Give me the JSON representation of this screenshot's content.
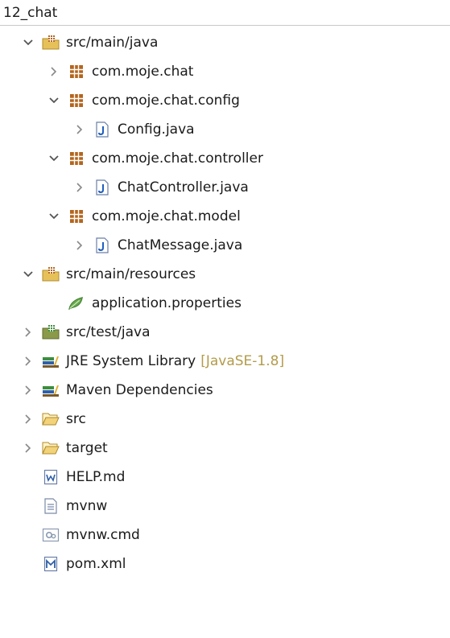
{
  "project": {
    "title": "12_chat"
  },
  "tree": [
    {
      "label": "src/main/java",
      "expanded": true
    },
    {
      "label": "com.moje.chat",
      "expanded": false
    },
    {
      "label": "com.moje.chat.config",
      "expanded": true
    },
    {
      "label": "Config.java",
      "expanded": false
    },
    {
      "label": "com.moje.chat.controller",
      "expanded": true
    },
    {
      "label": "ChatController.java",
      "expanded": false
    },
    {
      "label": "com.moje.chat.model",
      "expanded": true
    },
    {
      "label": "ChatMessage.java",
      "expanded": false
    },
    {
      "label": "src/main/resources",
      "expanded": true
    },
    {
      "label": "application.properties"
    },
    {
      "label": "src/test/java",
      "expanded": false
    },
    {
      "label": "JRE System Library",
      "decoration": "[JavaSE-1.8]",
      "expanded": false
    },
    {
      "label": "Maven Dependencies",
      "expanded": false
    },
    {
      "label": "src",
      "expanded": false
    },
    {
      "label": "target",
      "expanded": false
    },
    {
      "label": "HELP.md"
    },
    {
      "label": "mvnw"
    },
    {
      "label": "mvnw.cmd"
    },
    {
      "label": "pom.xml"
    }
  ],
  "colors": {
    "chevron": "#555555",
    "package": "#b5651d",
    "folder": "#e6c15a",
    "java_file": "#1f5fbf",
    "library_green": "#3c8f3c",
    "decoration": "#b39b4a",
    "leaf": "#6aa84f"
  },
  "icons": {
    "source_folder": "source-folder-icon",
    "package": "package-icon",
    "java_file": "java-file-icon",
    "properties_file": "properties-file-icon",
    "library": "library-icon",
    "folder": "folder-icon",
    "markdown_file": "markdown-file-icon",
    "text_file": "text-file-icon",
    "cmd_file": "cmd-file-icon",
    "maven_pom": "maven-pom-icon"
  }
}
